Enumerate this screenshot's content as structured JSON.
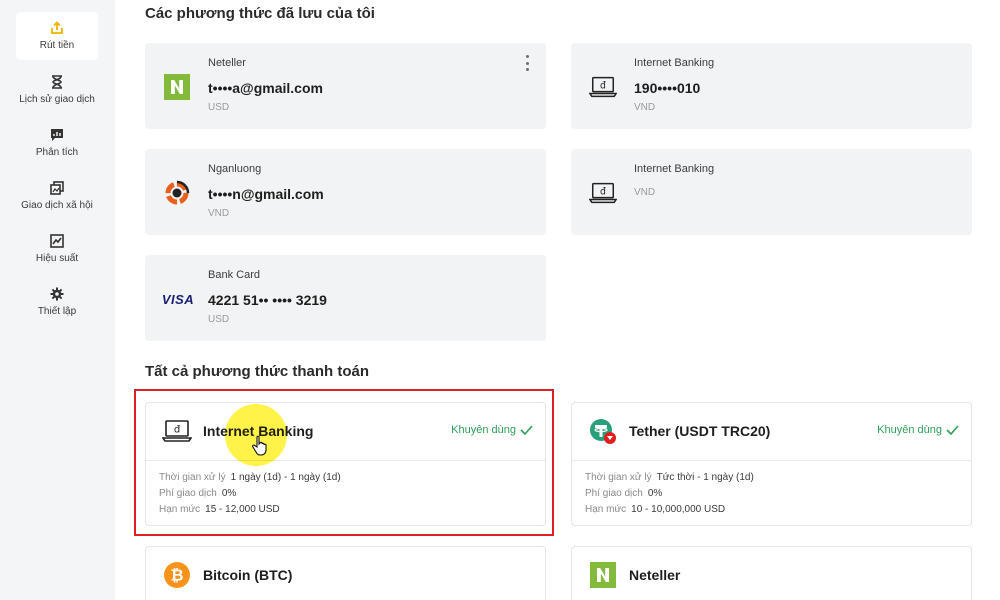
{
  "sidebar": {
    "items": [
      {
        "label": "Rút tiền",
        "icon": "withdraw-icon",
        "active": true
      },
      {
        "label": "Lịch sử giao dịch",
        "icon": "hourglass-icon"
      },
      {
        "label": "Phân tích",
        "icon": "chart-message-icon"
      },
      {
        "label": "Giao dịch xã hội",
        "icon": "social-trading-icon"
      },
      {
        "label": "Hiệu suất",
        "icon": "performance-icon"
      },
      {
        "label": "Thiết lập",
        "icon": "gear-icon"
      }
    ]
  },
  "saved_methods": {
    "title": "Các phương thức đã lưu của tôi",
    "cards": [
      {
        "name": "Neteller",
        "value": "t••••a@gmail.com",
        "currency": "USD",
        "icon": "neteller-logo"
      },
      {
        "name": "Internet Banking",
        "value": "190••••010",
        "currency": "VND",
        "icon": "laptop-dong-icon"
      },
      {
        "name": "Nganluong",
        "value": "t••••n@gmail.com",
        "currency": "VND",
        "icon": "nganluong-logo"
      },
      {
        "name": "Internet Banking",
        "value": "",
        "currency": "VND",
        "icon": "laptop-dong-icon"
      },
      {
        "name": "Bank Card",
        "value": "4221 51•• •••• 3219",
        "currency": "USD",
        "icon": "visa-logo",
        "logo_text": "VISA"
      }
    ]
  },
  "all_methods": {
    "title": "Tất cả phương thức thanh toán",
    "cards": [
      {
        "name": "Internet Banking",
        "recommended": "Khuyên dùng",
        "icon": "laptop-dong-icon",
        "details": [
          {
            "label": "Thời gian xử lý",
            "value": "1 ngày (1d) - 1 ngày (1d)"
          },
          {
            "label": "Phí giao dịch",
            "value": "0%"
          },
          {
            "label": "Hạn mức",
            "value": "15 - 12,000 USD"
          }
        ]
      },
      {
        "name": "Tether (USDT TRC20)",
        "recommended": "Khuyên dùng",
        "icon": "tether-logo",
        "details": [
          {
            "label": "Thời gian xử lý",
            "value": "Tức thời - 1 ngày (1d)"
          },
          {
            "label": "Phí giao dịch",
            "value": "0%"
          },
          {
            "label": "Hạn mức",
            "value": "10 - 10,000,000 USD"
          }
        ]
      },
      {
        "name": "Bitcoin (BTC)",
        "icon": "bitcoin-logo"
      },
      {
        "name": "Neteller",
        "icon": "neteller-logo"
      }
    ]
  },
  "colors": {
    "accent_yellow": "#f0b400",
    "recommended_green": "#2f9e5b",
    "neteller_green": "#83ba3b",
    "tether_teal": "#26a17b",
    "bitcoin_orange": "#f7931a",
    "highlight_red": "#e02020"
  }
}
